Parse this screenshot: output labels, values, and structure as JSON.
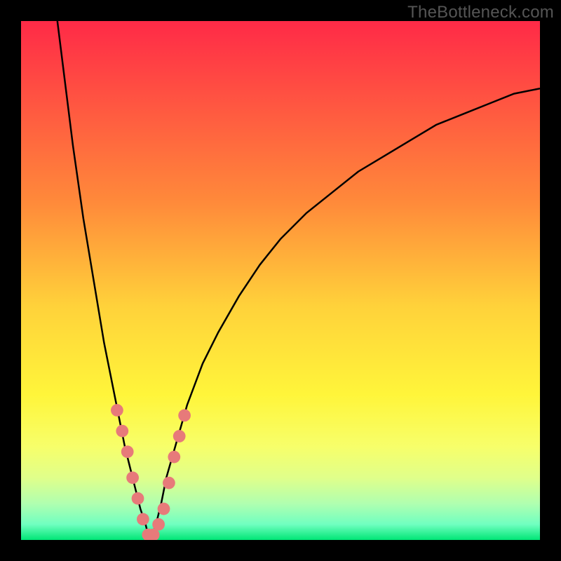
{
  "watermark": "TheBottleneck.com",
  "chart_data": {
    "type": "line",
    "title": "",
    "xlabel": "",
    "ylabel": "",
    "xlim": [
      0,
      100
    ],
    "ylim": [
      0,
      100
    ],
    "grid": false,
    "legend": false,
    "gradient_stops": [
      {
        "offset": 0.0,
        "color": "#ff2a47"
      },
      {
        "offset": 0.35,
        "color": "#ff8a3a"
      },
      {
        "offset": 0.55,
        "color": "#ffd23a"
      },
      {
        "offset": 0.72,
        "color": "#fff53a"
      },
      {
        "offset": 0.82,
        "color": "#f7ff6a"
      },
      {
        "offset": 0.88,
        "color": "#e0ff8a"
      },
      {
        "offset": 0.93,
        "color": "#b0ffb0"
      },
      {
        "offset": 0.97,
        "color": "#70ffc0"
      },
      {
        "offset": 1.0,
        "color": "#00e676"
      }
    ],
    "series": [
      {
        "name": "bottleneck-curve",
        "color": "#000000",
        "x": [
          7,
          8,
          9,
          10,
          11,
          12,
          13,
          14,
          15,
          16,
          17,
          18,
          19,
          20,
          21,
          22,
          23,
          24,
          24.5,
          25,
          26,
          27,
          28,
          30,
          32,
          35,
          38,
          42,
          46,
          50,
          55,
          60,
          65,
          70,
          75,
          80,
          85,
          90,
          95,
          100
        ],
        "y": [
          100,
          92,
          84,
          76,
          69,
          62,
          56,
          50,
          44,
          38,
          33,
          28,
          23,
          18,
          14,
          10,
          6,
          3,
          1,
          0,
          3,
          7,
          12,
          19,
          26,
          34,
          40,
          47,
          53,
          58,
          63,
          67,
          71,
          74,
          77,
          80,
          82,
          84,
          86,
          87
        ]
      }
    ],
    "markers": {
      "name": "chart-dots",
      "color": "#e77a7a",
      "radius_pct": 1.2,
      "points": [
        {
          "x": 18.5,
          "y": 25
        },
        {
          "x": 19.5,
          "y": 21
        },
        {
          "x": 20.5,
          "y": 17
        },
        {
          "x": 21.5,
          "y": 12
        },
        {
          "x": 22.5,
          "y": 8
        },
        {
          "x": 23.5,
          "y": 4
        },
        {
          "x": 24.5,
          "y": 1
        },
        {
          "x": 25.5,
          "y": 1
        },
        {
          "x": 26.5,
          "y": 3
        },
        {
          "x": 27.5,
          "y": 6
        },
        {
          "x": 28.5,
          "y": 11
        },
        {
          "x": 29.5,
          "y": 16
        },
        {
          "x": 30.5,
          "y": 20
        },
        {
          "x": 31.5,
          "y": 24
        }
      ]
    }
  }
}
